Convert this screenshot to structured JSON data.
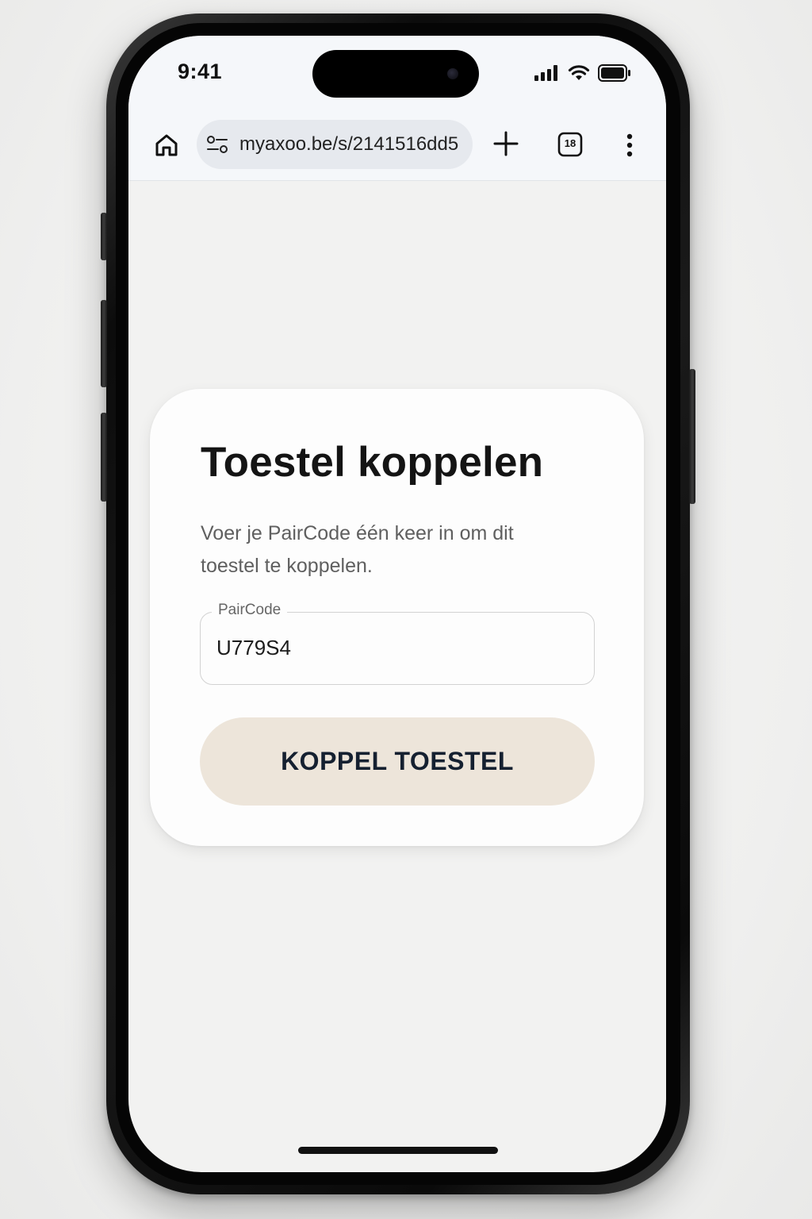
{
  "status_bar": {
    "time": "9:41"
  },
  "browser": {
    "url": "myaxoo.be/s/2141516dd5",
    "tab_count": "18",
    "icons": [
      "home-icon",
      "site-settings-icon",
      "plus-icon",
      "tabs-icon",
      "more-vert-icon"
    ]
  },
  "card": {
    "title": "Toestel koppelen",
    "description": "Voer je PairCode één keer in om dit toestel te koppelen.",
    "field_label": "PairCode",
    "field_value": "U779S4",
    "button_label": "KOPPEL TOESTEL"
  },
  "colors": {
    "button_bg": "#ede5da",
    "button_text": "#152030",
    "page_bg": "#f2f2f1",
    "card_bg": "#fdfdfd"
  }
}
